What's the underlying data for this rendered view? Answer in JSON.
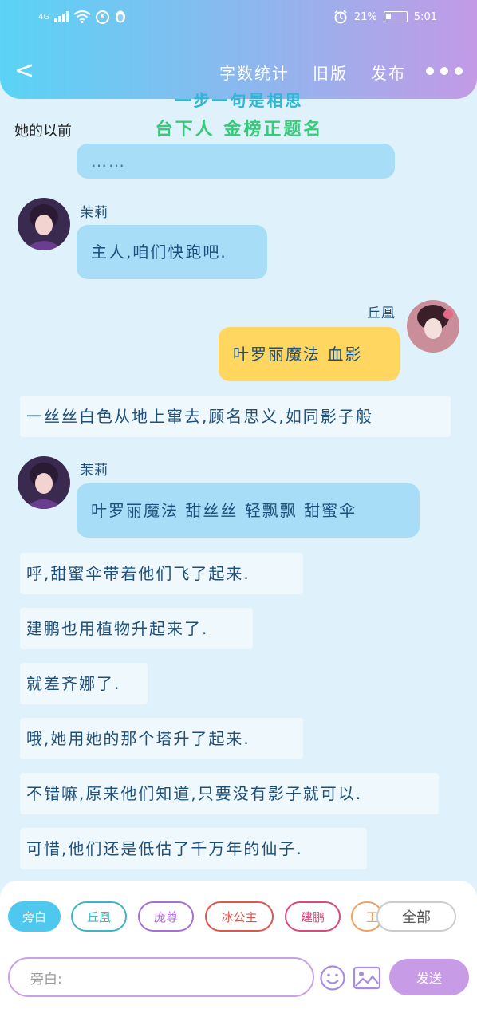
{
  "status": {
    "carrier": "4G",
    "battery": "21%",
    "time": "5:01",
    "k_icon": "K"
  },
  "nav": {
    "back_label": "<",
    "word_count": "字数统计",
    "old_version": "旧版",
    "publish": "发布"
  },
  "watermark": {
    "line1": "一步一句是相思",
    "line2": "台下人 金榜正题名"
  },
  "chapter_title": "她的以前",
  "messages": {
    "cut_bubble": "……",
    "m1_name": "茉莉",
    "m1_text": "主人,咱们快跑吧.",
    "m2_name": "丘凰",
    "m2_text": "叶罗丽魔法 血影",
    "n1": "一丝丝白色从地上窜去,顾名思义,如同影子般",
    "m3_name": "茉莉",
    "m3_text": "叶罗丽魔法 甜丝丝 轻飘飘 甜蜜伞",
    "n2": "呼,甜蜜伞带着他们飞了起来.",
    "n3": "建鹏也用植物升起来了.",
    "n4": "就差齐娜了.",
    "n5": "哦,她用她的那个塔升了起来.",
    "n6": "不错嘛,原来他们知道,只要没有影子就可以.",
    "n7": "可惜,他们还是低估了千万年的仙子."
  },
  "roles": {
    "narrator": "旁白",
    "qiuhuang": "丘凰",
    "pangzun": "庞尊",
    "bing": "冰公主",
    "jianpeng": "建鹏",
    "partial": "王",
    "all": "全部"
  },
  "composer": {
    "placeholder": "旁白:",
    "send": "发送"
  },
  "colors": {
    "narrator": "#4ec8ef",
    "qiuhuang": "#3cb6c2",
    "pangzun": "#a76fd6",
    "bing": "#e0564d",
    "jianpeng": "#e0477a",
    "partial": "#f0a060",
    "all": "#bbbbbb"
  }
}
